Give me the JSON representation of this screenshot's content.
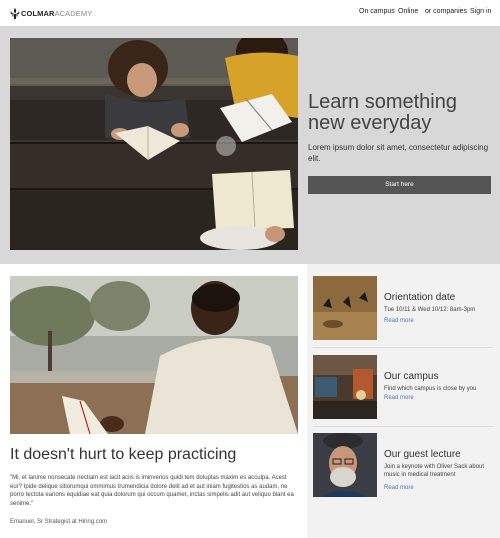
{
  "header": {
    "logo_bold": "COLMAR",
    "logo_light": "ACADEMY",
    "nav": [
      "On campus",
      "Online",
      "or companies",
      "Sign in"
    ]
  },
  "hero": {
    "title": "Learn something new everyday",
    "subtitle": "Lorem ipsum dolor sit amet, consectetur adipiscing elit.",
    "button_label": "Start here"
  },
  "article": {
    "title": "It doesn't hurt to keep practicing",
    "quote": "\"Mi, et lanime nonsecate nectiam est lacit aciis is iminverios quidi tem doluptas maxim es acculpa. Acest eur? Ipide delique sitiorumqui ommimus trumendicia dolore delit ad et aut iniam fugitestios as audam, ne porro tectota earions equidiae eat quia dolorum qui occum quamet, inctas simpelis adit aut veliquo blant ea senime.\"",
    "author": "Emanuel, Sr Strategist at Hiring.com"
  },
  "sidebar": {
    "cards": [
      {
        "title": "Orientation date",
        "desc": "Tue 10/11 & Wed 10/12: 8am-3pm",
        "link": "Read more"
      },
      {
        "title": "Our campus",
        "desc": "Find which campus is close by you",
        "link": "Read more"
      },
      {
        "title": "Our guest lecture",
        "desc": "Join a keynote with Oliver Sack about music in medical treatment",
        "link": "Read more"
      }
    ]
  },
  "colors": {
    "hero_bg": "#d8d8d8",
    "button_bg": "#555555",
    "link": "#4a7bb7",
    "sidebar_bg": "#f2f2f2"
  },
  "icons": {
    "logo": "fleur-de-lis-icon"
  }
}
